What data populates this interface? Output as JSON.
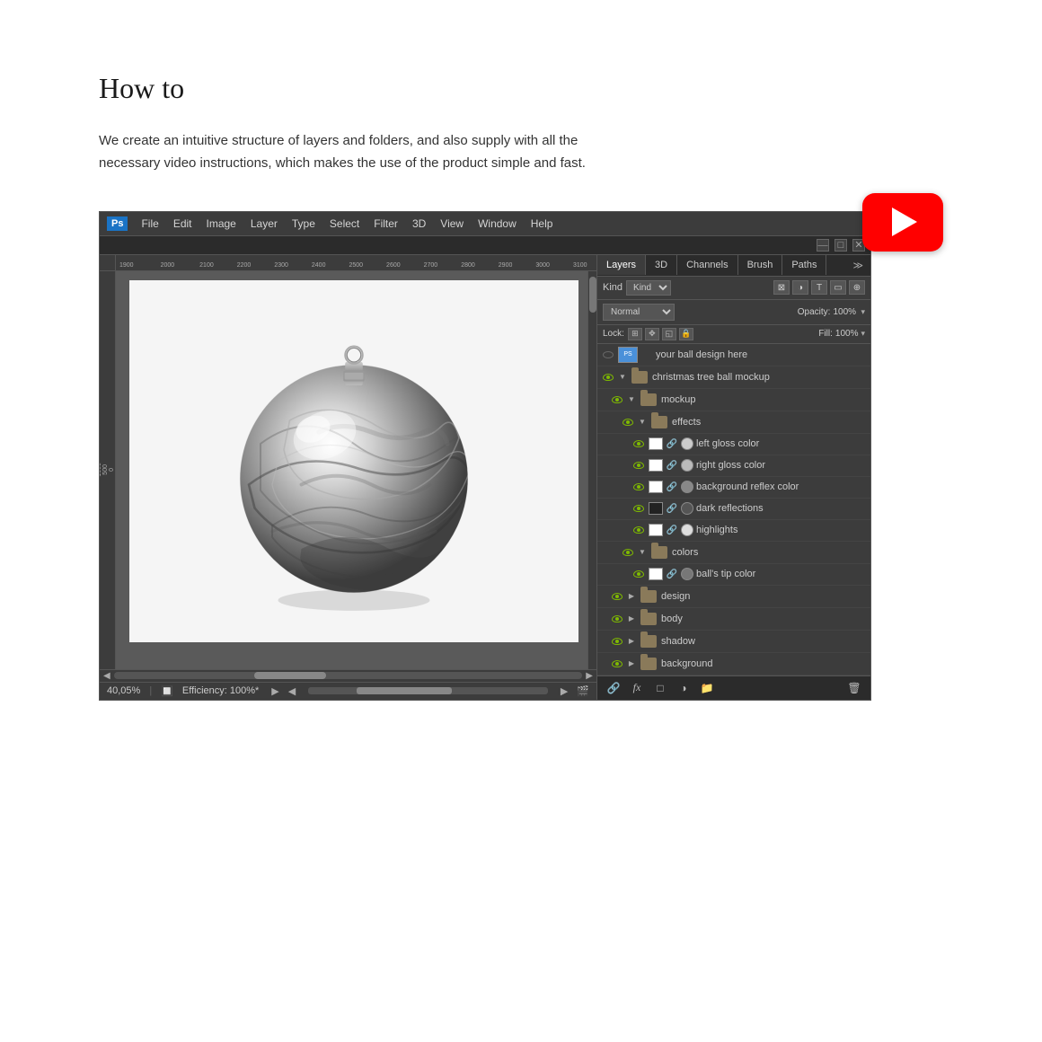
{
  "page": {
    "title": "How to",
    "description": "We create an intuitive structure of layers and folders, and also supply with all the necessary video instructions, which makes the use of the product simple and fast."
  },
  "photoshop": {
    "logo": "Ps",
    "menu": [
      "File",
      "Edit",
      "Image",
      "Layer",
      "Type",
      "Select",
      "Filter",
      "3D",
      "View",
      "Window",
      "Help"
    ],
    "window_buttons": [
      "—",
      "□",
      "✕"
    ],
    "zoom": "40,05%",
    "status": "Efficiency: 100%*",
    "ruler_numbers": [
      "1900",
      "2000",
      "2100",
      "2200",
      "2300",
      "2400",
      "2500",
      "2600",
      "2700",
      "2800",
      "2900",
      "3000",
      "3100"
    ]
  },
  "layers_panel": {
    "tabs": [
      "Layers",
      "3D",
      "Channels",
      "Brush",
      "Paths"
    ],
    "active_tab": "Layers",
    "filter_label": "Kind",
    "blend_mode": "Normal",
    "opacity_label": "Opacity:",
    "opacity_value": "100%",
    "fill_label": "Fill:",
    "fill_value": "100%",
    "lock_label": "Lock:",
    "layers": [
      {
        "id": 1,
        "name": "your ball design here",
        "indent": 0,
        "visible": false,
        "type": "layer",
        "has_thumb": true
      },
      {
        "id": 2,
        "name": "christmas tree ball mockup",
        "indent": 0,
        "visible": true,
        "type": "folder",
        "expanded": true
      },
      {
        "id": 3,
        "name": "mockup",
        "indent": 1,
        "visible": true,
        "type": "folder",
        "expanded": true
      },
      {
        "id": 4,
        "name": "effects",
        "indent": 2,
        "visible": true,
        "type": "folder",
        "expanded": true
      },
      {
        "id": 5,
        "name": "left gloss color",
        "indent": 3,
        "visible": true,
        "type": "layer",
        "has_squares": true
      },
      {
        "id": 6,
        "name": "right gloss color",
        "indent": 3,
        "visible": true,
        "type": "layer",
        "has_squares": true
      },
      {
        "id": 7,
        "name": "background reflex color",
        "indent": 3,
        "visible": true,
        "type": "layer",
        "has_squares": true
      },
      {
        "id": 8,
        "name": "dark reflections",
        "indent": 3,
        "visible": true,
        "type": "layer",
        "has_squares": true,
        "dark": true
      },
      {
        "id": 9,
        "name": "highlights",
        "indent": 3,
        "visible": true,
        "type": "layer",
        "has_squares": true
      },
      {
        "id": 10,
        "name": "colors",
        "indent": 2,
        "visible": true,
        "type": "folder",
        "expanded": true
      },
      {
        "id": 11,
        "name": "ball's tip color",
        "indent": 3,
        "visible": true,
        "type": "layer",
        "has_squares": true
      },
      {
        "id": 12,
        "name": "design",
        "indent": 1,
        "visible": true,
        "type": "folder",
        "collapsed": true
      },
      {
        "id": 13,
        "name": "body",
        "indent": 1,
        "visible": true,
        "type": "folder",
        "collapsed": true
      },
      {
        "id": 14,
        "name": "shadow",
        "indent": 1,
        "visible": true,
        "type": "folder",
        "collapsed": true
      },
      {
        "id": 15,
        "name": "background",
        "indent": 1,
        "visible": true,
        "type": "folder",
        "collapsed": true
      }
    ],
    "toolbar_buttons": [
      "link-icon",
      "fx-icon",
      "mask-icon",
      "adjustment-icon",
      "folder-icon",
      "trash-icon"
    ]
  },
  "youtube": {
    "button_label": "▶"
  }
}
